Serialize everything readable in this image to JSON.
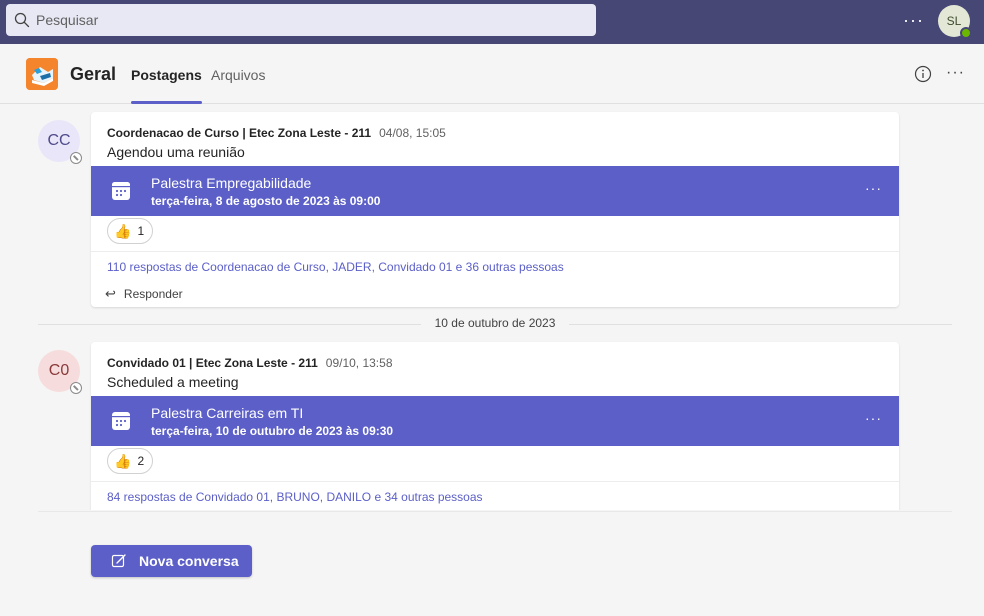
{
  "search": {
    "placeholder": "Pesquisar"
  },
  "topbar": {
    "more": "···",
    "user_initials": "SL"
  },
  "channel": {
    "title": "Geral",
    "tabs": [
      {
        "label": "Postagens",
        "active": true
      },
      {
        "label": "Arquivos",
        "active": false
      }
    ],
    "more": "···"
  },
  "posts": [
    {
      "avatar_initials": "CC",
      "avatar_bg": "#e8e6f8",
      "avatar_color": "#4f4b8a",
      "author": "Coordenacao de Curso | Etec Zona Leste - 211",
      "time": "04/08, 15:05",
      "message": "Agendou uma reunião",
      "meeting_title": "Palestra Empregabilidade",
      "meeting_when": "terça-feira, 8 de agosto de 2023 às 09:00",
      "reaction_count": "1",
      "replies": "110 respostas de Coordenacao de Curso, JADER, Convidado 01 e 36 outras pessoas",
      "reply_label": "Responder"
    },
    {
      "avatar_initials": "C0",
      "avatar_bg": "#f6dcdc",
      "avatar_color": "#8a3a3a",
      "author": "Convidado 01 | Etec Zona Leste - 211",
      "time": "09/10, 13:58",
      "message": "Scheduled a meeting",
      "meeting_title": "Palestra Carreiras em TI",
      "meeting_when": "terça-feira, 10 de outubro de 2023 às 09:30",
      "reaction_count": "2",
      "replies": "84 respostas de Convidado 01, BRUNO, DANILO e 34 outras pessoas"
    }
  ],
  "date_separator": "10 de outubro de 2023",
  "meeting_more": "···",
  "new_conversation": "Nova conversa",
  "colors": {
    "accent": "#5b5fc7",
    "topbar": "#464775",
    "team_logo": "#f5852c"
  }
}
